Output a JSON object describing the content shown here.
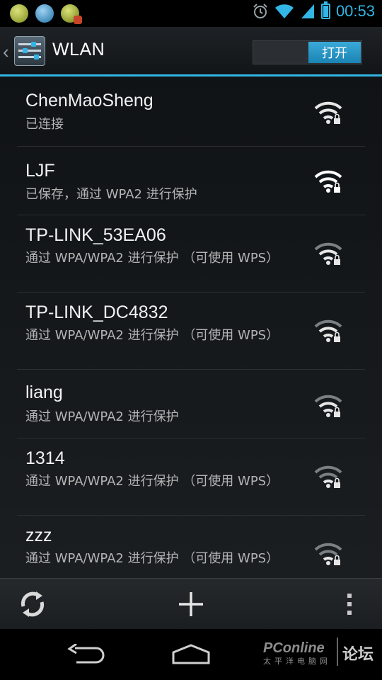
{
  "status_bar": {
    "time": "00:53",
    "notifications": [
      "app-notification-icon",
      "app-notification-icon",
      "app-notification-icon"
    ],
    "icons": [
      "alarm-icon",
      "wifi-icon",
      "cell-signal-icon",
      "battery-icon"
    ],
    "accent": "#33b5e5"
  },
  "action_bar": {
    "title": "WLAN",
    "toggle_label": "打开",
    "toggle_state": "on"
  },
  "networks": [
    {
      "ssid": "ChenMaoSheng",
      "status": "已连接",
      "secured": true
    },
    {
      "ssid": "LJF",
      "status": "已保存，通过 WPA2 进行保护",
      "secured": true
    },
    {
      "ssid": "TP-LINK_53EA06",
      "status": "通过 WPA/WPA2 进行保护 （可使用 WPS）",
      "secured": true
    },
    {
      "ssid": "TP-LINK_DC4832",
      "status": "通过 WPA/WPA2 进行保护 （可使用 WPS）",
      "secured": true
    },
    {
      "ssid": "liang",
      "status": "通过 WPA/WPA2 进行保护",
      "secured": true
    },
    {
      "ssid": "1314",
      "status": "通过 WPA/WPA2 进行保护 （可使用 WPS）",
      "secured": true
    },
    {
      "ssid": "zzz",
      "status": "通过 WPA/WPA2 进行保护 （可使用 WPS）",
      "secured": true
    }
  ],
  "bottom_bar": {
    "actions": [
      "refresh-icon",
      "add-network-icon",
      "overflow-menu-icon"
    ]
  },
  "nav_bar": {
    "buttons": [
      "back-icon",
      "home-icon"
    ]
  },
  "watermark": {
    "brand": "PConline",
    "chinese": "论坛",
    "sub": "太平洋电脑网"
  }
}
